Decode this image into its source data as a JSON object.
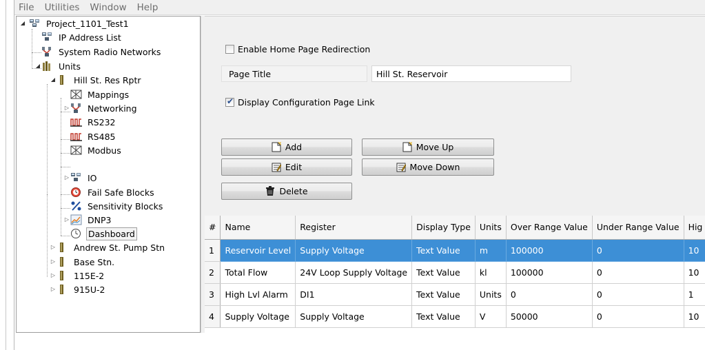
{
  "menu": [
    "File",
    "Utilities",
    "Window",
    "Help"
  ],
  "tree": {
    "nodes": [
      {
        "label": "Project_1101_Test1",
        "icon": "project-icon",
        "expanded": true
      },
      {
        "label": "IP Address List",
        "icon": "ip-list-icon"
      },
      {
        "label": "System Radio Networks",
        "icon": "radio-network-icon"
      },
      {
        "label": "Units",
        "icon": "units-icon",
        "expanded": true
      },
      {
        "label": "Hill St. Res Rptr",
        "icon": "unit-icon",
        "expanded": true
      },
      {
        "label": "Mappings",
        "icon": "mappings-icon"
      },
      {
        "label": "Networking",
        "icon": "networking-icon",
        "collapsed": true
      },
      {
        "label": "RS232",
        "icon": "serial-port-icon"
      },
      {
        "label": "RS485",
        "icon": "serial-port-icon"
      },
      {
        "label": "Modbus",
        "icon": "modbus-icon"
      },
      {
        "label": "IO",
        "icon": "io-icon",
        "collapsed": true
      },
      {
        "label": "Fail Safe Blocks",
        "icon": "fail-safe-icon"
      },
      {
        "label": "Sensitivity Blocks",
        "icon": "sensitivity-icon"
      },
      {
        "label": "DNP3",
        "icon": "dnp3-icon",
        "collapsed": true
      },
      {
        "label": "Dashboard",
        "icon": "dashboard-icon",
        "selected": true
      },
      {
        "label": "Andrew St. Pump Stn",
        "icon": "unit-icon",
        "collapsed": true
      },
      {
        "label": "Base Stn.",
        "icon": "unit-icon",
        "collapsed": true
      },
      {
        "label": "115E-2",
        "icon": "unit-icon",
        "collapsed": true
      },
      {
        "label": "915U-2",
        "icon": "unit-icon",
        "collapsed": true
      }
    ]
  },
  "settings": {
    "enable_redirect_label": "Enable Home Page Redirection",
    "enable_redirect_checked": false,
    "page_title_label": "Page Title",
    "page_title_value": "Hill St. Reservoir",
    "display_config_label": "Display Configuration Page Link",
    "display_config_checked": true
  },
  "buttons": {
    "add": "Add",
    "edit": "Edit",
    "delete": "Delete",
    "move_up": "Move Up",
    "move_down": "Move Down"
  },
  "grid": {
    "columns": [
      "#",
      "Name",
      "Register",
      "Display Type",
      "Units",
      "Over Range Value",
      "Under Range Value",
      "Hig"
    ],
    "rows": [
      [
        "1",
        "Reservoir Level",
        "Supply Voltage",
        "Text Value",
        "m",
        "100000",
        "0",
        "10"
      ],
      [
        "2",
        "Total Flow",
        "24V Loop Supply Voltage",
        "Text Value",
        "kl",
        "100000",
        "0",
        "10"
      ],
      [
        "3",
        "High Lvl Alarm",
        "DI1",
        "Text Value",
        "Units",
        "0",
        "0",
        "1"
      ],
      [
        "4",
        "Supply Voltage",
        "Supply Voltage",
        "Text Value",
        "V",
        "50000",
        "0",
        "10"
      ]
    ],
    "selected_row": 0
  },
  "colors": {
    "selection": "#3d8fd6",
    "panel_bg": "#f0f0f0"
  }
}
